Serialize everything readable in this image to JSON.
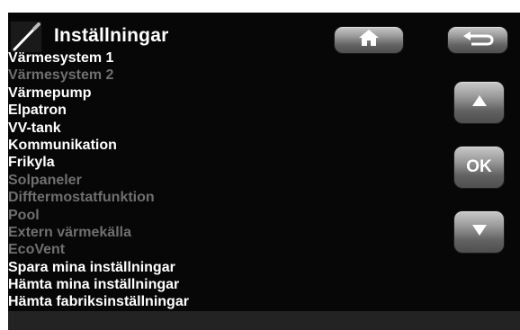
{
  "header": {
    "title": "Inställningar",
    "icon": "wrench-icon"
  },
  "menu": {
    "items": [
      {
        "label": "Värmesystem 1",
        "enabled": true
      },
      {
        "label": "Värmesystem 2",
        "enabled": false
      },
      {
        "label": "Värmepump",
        "enabled": true
      },
      {
        "label": "Elpatron",
        "enabled": true
      },
      {
        "label": "VV-tank",
        "enabled": true
      },
      {
        "label": "Kommunikation",
        "enabled": true
      },
      {
        "label": "Frikyla",
        "enabled": true
      },
      {
        "label": "Solpaneler",
        "enabled": false
      },
      {
        "label": "Difftermostatfunktion",
        "enabled": false
      },
      {
        "label": "Pool",
        "enabled": false
      },
      {
        "label": "Extern värmekälla",
        "enabled": false
      },
      {
        "label": "EcoVent",
        "enabled": false
      },
      {
        "label": "Spara mina inställningar",
        "enabled": true
      },
      {
        "label": "Hämta mina inställningar",
        "enabled": true
      },
      {
        "label": "Hämta fabriksinställningar",
        "enabled": true
      }
    ]
  },
  "buttons": {
    "home_icon": "home-icon",
    "back_icon": "back-arrow-icon",
    "up_icon": "arrow-up-icon",
    "ok_label": "OK",
    "down_icon": "arrow-down-icon"
  },
  "colors": {
    "background": "#070707",
    "text_enabled": "#ffffff",
    "text_disabled": "#6f6f6f",
    "button_top": "#c9c9c9",
    "button_bottom": "#4e4e4e"
  }
}
